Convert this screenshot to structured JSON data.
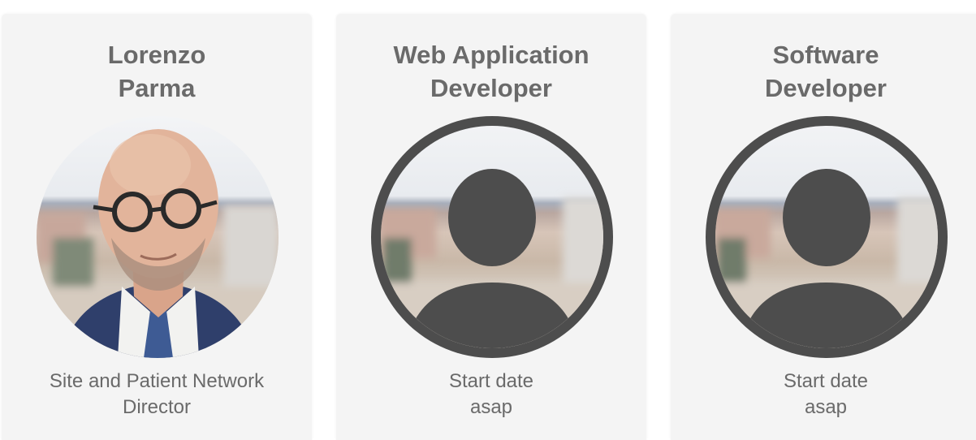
{
  "cards": [
    {
      "title_line1": "Lorenzo",
      "title_line2": "Parma",
      "caption_line1": "Site and Patient Network",
      "caption_line2": "Director",
      "avatar": "person-photo"
    },
    {
      "title_line1": "Web Application",
      "title_line2": "Developer",
      "caption_line1": "Start date",
      "caption_line2": "asap",
      "avatar": "person-placeholder-icon"
    },
    {
      "title_line1": "Software",
      "title_line2": "Developer",
      "caption_line1": "Start date",
      "caption_line2": "asap",
      "avatar": "person-placeholder-icon"
    }
  ],
  "colors": {
    "card_background": "#f4f4f4",
    "text": "#6a6a6a",
    "placeholder_ring": "#4d4d4d"
  }
}
